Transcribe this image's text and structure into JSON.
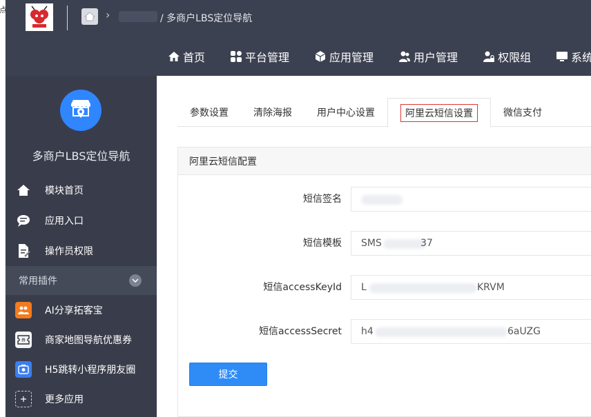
{
  "window_clip": "点",
  "header": {
    "breadcrumb_current": "/ 多商户LBS定位导航",
    "nav": [
      {
        "label": "首页",
        "icon": "home-icon"
      },
      {
        "label": "平台管理",
        "icon": "apps-icon"
      },
      {
        "label": "应用管理",
        "icon": "cube-icon"
      },
      {
        "label": "用户管理",
        "icon": "users-icon"
      },
      {
        "label": "权限组",
        "icon": "user-lock-icon"
      },
      {
        "label": "系统",
        "icon": "monitor-icon"
      }
    ]
  },
  "sidebar": {
    "app_title": "多商户LBS定位导航",
    "items": [
      {
        "label": "模块首页",
        "icon": "home-icon"
      },
      {
        "label": "应用入口",
        "icon": "chat-icon"
      },
      {
        "label": "操作员权限",
        "icon": "doc-edit-icon"
      }
    ],
    "group_label": "常用插件",
    "plugins": [
      {
        "label": "AI分享拓客宝",
        "icon": "share-users-icon",
        "color": "#f37b1d"
      },
      {
        "label": "商家地图导航优惠券",
        "icon": "coupon-icon",
        "color": "#2b2f3a"
      },
      {
        "label": "H5跳转小程序朋友圈",
        "icon": "miniapp-icon",
        "color": "#3b7ef0"
      },
      {
        "label": "更多应用",
        "icon": "plus-icon",
        "color": "#393d4b"
      }
    ]
  },
  "tabs": [
    {
      "label": "参数设置",
      "active": false
    },
    {
      "label": "清除海报",
      "active": false
    },
    {
      "label": "用户中心设置",
      "active": false
    },
    {
      "label": "阿里云短信设置",
      "active": true
    },
    {
      "label": "微信支付",
      "active": false
    }
  ],
  "panel": {
    "title": "阿里云短信配置",
    "fields": [
      {
        "label": "短信签名",
        "prefix": "",
        "suffix": ""
      },
      {
        "label": "短信模板",
        "prefix": "SMS",
        "suffix": "37"
      },
      {
        "label": "短信accessKeyId",
        "prefix": "L",
        "suffix": "KRVM"
      },
      {
        "label": "短信accessSecret",
        "prefix": "h4",
        "suffix": "6aUZG"
      }
    ],
    "submit_label": "提交"
  },
  "colors": {
    "topbar": "#3c4151",
    "sidebar": "#393d4b",
    "primary": "#2f8cf7",
    "active_tab_highlight": "#e1332e"
  }
}
